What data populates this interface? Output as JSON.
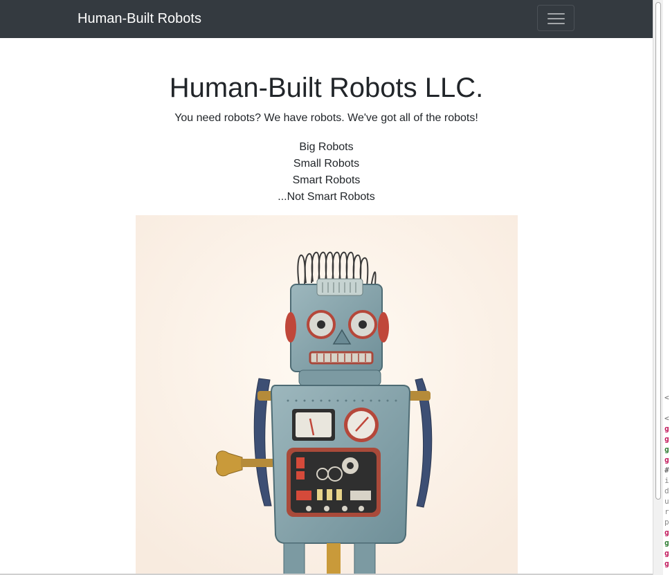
{
  "navbar": {
    "brand": "Human-Built Robots",
    "toggle_icon": "hamburger-icon"
  },
  "hero": {
    "title": "Human-Built Robots LLC.",
    "lead": "You need robots? We have robots. We've got all of the robots!",
    "features": [
      "Big Robots",
      "Small Robots",
      "Smart Robots",
      "...Not Smart Robots"
    ]
  },
  "side_panel": {
    "chars": [
      "<",
      "<",
      "g",
      "g",
      "g",
      "g",
      "#",
      "i",
      "d",
      "u",
      "r",
      "p",
      "g",
      "g",
      "g",
      "g"
    ]
  },
  "colors": {
    "navbar_bg": "#343a40",
    "robot_body": "#7fa0a8",
    "photo_bg": "#fcf2e8"
  }
}
